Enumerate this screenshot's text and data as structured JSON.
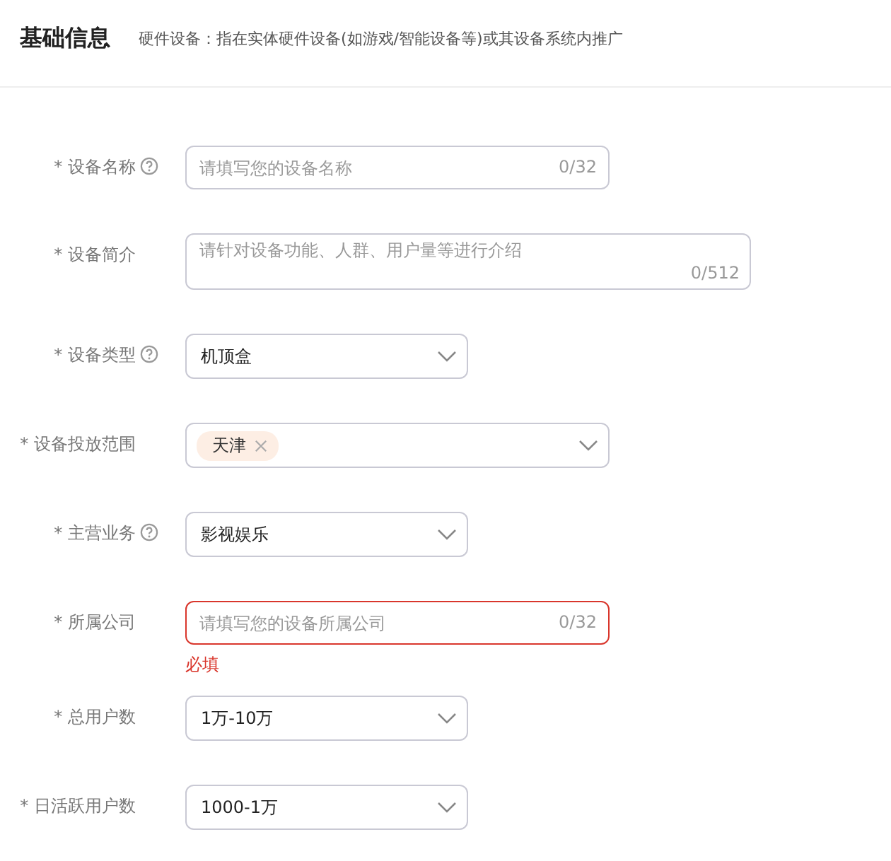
{
  "header": {
    "title": "基础信息",
    "subtitle": "硬件设备：指在实体硬件设备(如游戏/智能设备等)或其设备系统内推广"
  },
  "fields": [
    {
      "label": "* 设备名称",
      "help": true,
      "kind": "input",
      "placeholder": "请填写您的设备名称",
      "counter": "0/32",
      "error": false
    },
    {
      "label": "* 设备简介",
      "help": false,
      "kind": "textarea",
      "placeholder": "请针对设备功能、人群、用户量等进行介绍",
      "counter": "0/512",
      "error": false
    },
    {
      "label": "* 设备类型",
      "help": true,
      "kind": "select",
      "value": "机顶盒"
    },
    {
      "label": "* 设备投放范围",
      "help": false,
      "kind": "tags",
      "tags": [
        "天津"
      ]
    },
    {
      "label": "* 主营业务",
      "help": true,
      "kind": "select",
      "value": "影视娱乐"
    },
    {
      "label": "* 所属公司",
      "help": false,
      "kind": "input",
      "placeholder": "请填写您的设备所属公司",
      "counter": "0/32",
      "error": true,
      "error_text": "必填"
    },
    {
      "label": "* 总用户数",
      "help": false,
      "kind": "select",
      "value": "1万-10万"
    },
    {
      "label": "* 日活跃用户数",
      "help": false,
      "kind": "select",
      "value": "1000-1万"
    }
  ]
}
